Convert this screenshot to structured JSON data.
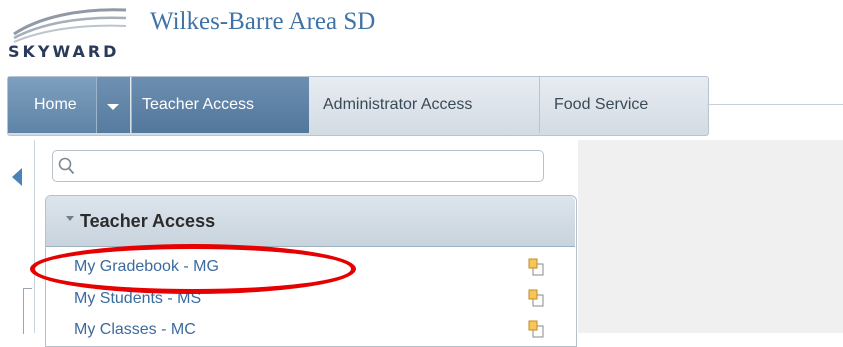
{
  "header": {
    "logo_text": "SKYWARD",
    "site_title": "Wilkes-Barre Area SD"
  },
  "nav": {
    "home": "Home",
    "teacher_access": "Teacher Access",
    "administrator_access": "Administrator Access",
    "food_service": "Food Service"
  },
  "search": {
    "value": "",
    "placeholder": ""
  },
  "panel": {
    "title": "Teacher Access",
    "items": [
      {
        "label": "My Gradebook - MG",
        "icon": "add-to-favorites-icon"
      },
      {
        "label": "My Students - MS",
        "icon": "add-to-favorites-icon"
      },
      {
        "label": "My Classes - MC",
        "icon": "add-to-favorites-icon"
      }
    ]
  },
  "annotation": {
    "color": "#e60000",
    "target": "My Gradebook - MG"
  },
  "colors": {
    "nav_active": "#5f84a7",
    "link": "#3a6b9e",
    "title": "#3f73a6"
  }
}
